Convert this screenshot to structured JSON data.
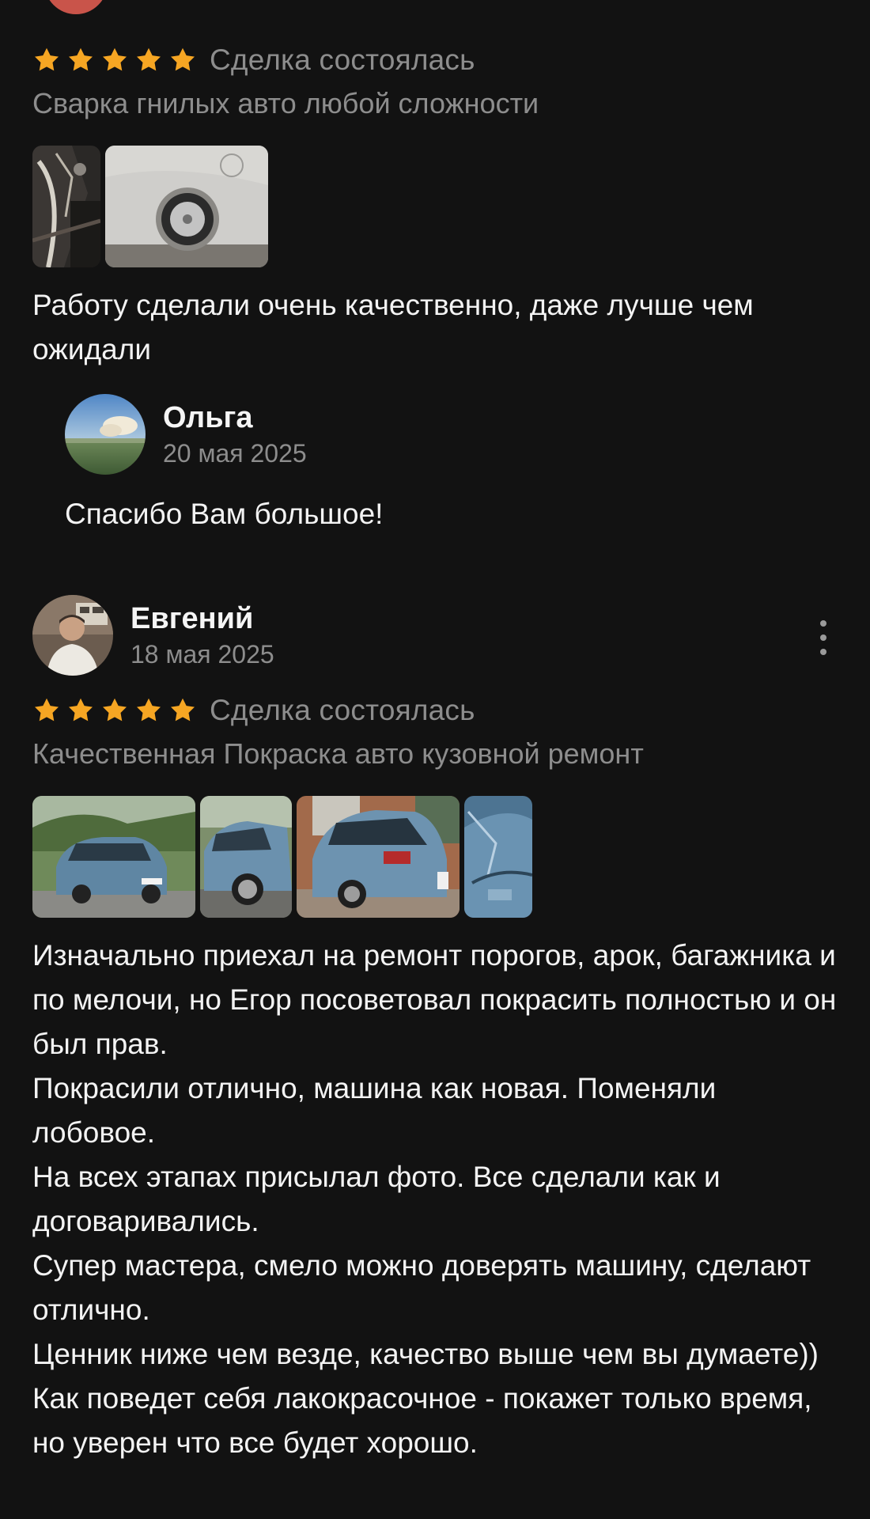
{
  "review1": {
    "rating": 5,
    "deal_status": "Сделка состоялась",
    "service": "Сварка гнилых авто любой сложности",
    "photos": [
      "welding-photo",
      "silver-car-photo"
    ],
    "text": "Работу сделали очень качественно, даже лучше чем ожидали"
  },
  "reply": {
    "author": "Ольга",
    "date": "20 мая 2025",
    "text": "Спасибо Вам большое!"
  },
  "review2": {
    "author": "Евгений",
    "date": "18 мая 2025",
    "rating": 5,
    "deal_status": "Сделка состоялась",
    "service": "Качественная Покраска авто кузовной ремонт",
    "photos": [
      "blue-car-front-photo",
      "blue-car-side-photo",
      "blue-car-rear-photo",
      "blue-car-hood-photo"
    ],
    "text": "Изначально приехал на ремонт порогов, арок, багажника и по мелочи, но Егор посоветовал покрасить полностью и он был прав.\nПокрасили отлично, машина как новая. Поменяли лобовое.\nНа всех этапах присылал фото. Все сделали как и договаривались.\nСупер мастера, смело можно доверять машину, сделают отлично.\nЦенник ниже чем везде, качество выше чем вы думаете))\nКак поведет себя лакокрасочное - покажет только время, но уверен что все будет хорошо."
  },
  "colors": {
    "background": "#121212",
    "star": "#f6a623",
    "muted_text": "#8d8d8d",
    "primary_text": "#f3f3f3"
  },
  "icons": {
    "star": "star-icon",
    "more": "more-vertical-icon"
  }
}
